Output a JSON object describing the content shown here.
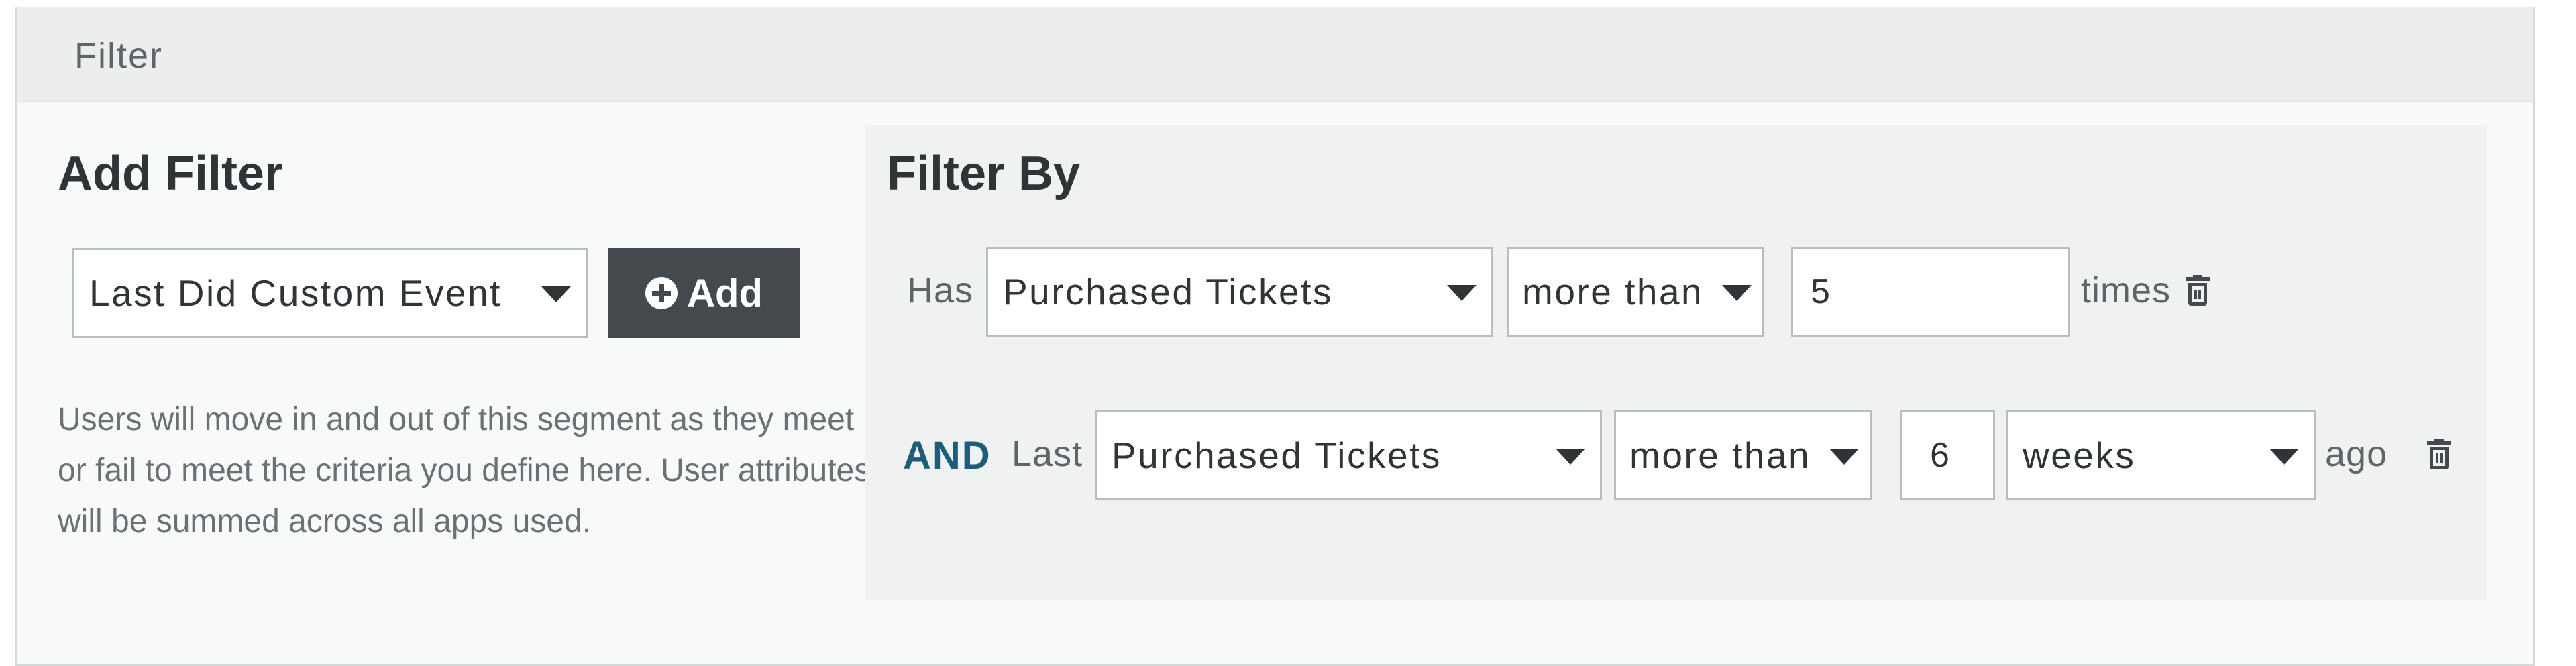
{
  "panel": {
    "title": "Filter"
  },
  "add_filter": {
    "title": "Add Filter",
    "select_value": "Last Did Custom Event",
    "add_button_label": "Add",
    "help_text": "Users will move in and out of this segment as they meet or fail to meet the criteria you define here. User attributes will be summed across all apps used."
  },
  "filter_by": {
    "title": "Filter By",
    "row1": {
      "prefix": "Has",
      "event": "Purchased Tickets",
      "comparator": "more than",
      "count": "5",
      "suffix": "times"
    },
    "row2": {
      "conjunction": "AND",
      "prefix": "Last",
      "event": "Purchased Tickets",
      "comparator": "more than",
      "amount": "6",
      "unit": "weeks",
      "suffix": "ago"
    }
  },
  "colors": {
    "accent_and": "#1d5d7a",
    "button_bg": "#43494d",
    "header_bg": "#eceeee"
  },
  "icons": [
    "plus-circle-icon",
    "caret-down-icon",
    "trash-icon"
  ]
}
